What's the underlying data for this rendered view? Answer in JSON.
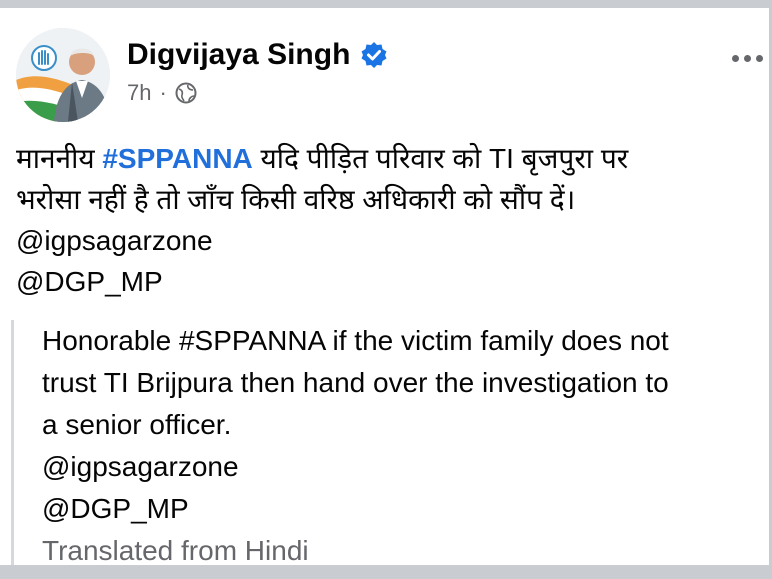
{
  "post": {
    "author": "Digvijaya Singh",
    "timestamp": "7h",
    "separator": "·",
    "verified_icon": "verified-badge-icon",
    "audience_icon": "globe-icon",
    "more_icon": "more-options-icon",
    "hindi": {
      "line1_before": "माननीय ",
      "hashtag": "#SPPANNA",
      "line1_after": " यदि पीड़ित परिवार को TI बृजपुरा पर",
      "line2": "भरोसा नहीं है तो जाँच किसी वरिष्ठ अधिकारी को सौंप दें।",
      "mention1": "@igpsagarzone",
      "mention2": "@DGP_MP"
    },
    "translation": {
      "line1": "Honorable #SPPANNA if the victim family does not",
      "line2": "trust TI Brijpura then hand over the investigation to",
      "line3": "a senior officer.",
      "mention1": "@igpsagarzone",
      "mention2": "@DGP_MP",
      "note": "Translated from Hindi"
    }
  },
  "colors": {
    "hashtag": "#216fdb",
    "verified": "#1b74e4",
    "secondary_text": "#65676b",
    "frame": "#c9ccd1"
  }
}
